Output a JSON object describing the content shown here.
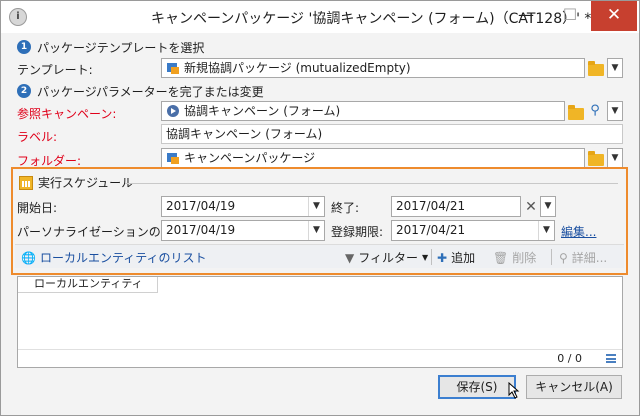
{
  "window": {
    "title": "キャンペーンパッケージ '協調キャンペーン (フォーム)（CAT128）' *",
    "app_icon": "i",
    "minimize": "—",
    "maximize": "☐",
    "close": "✕"
  },
  "steps": [
    {
      "num": "1",
      "label": "パッケージテンプレートを選択"
    },
    {
      "num": "2",
      "label": "パッケージパラメーターを完了または変更"
    }
  ],
  "form": {
    "template_label": "テンプレート:",
    "template_value": "新規協調パッケージ (mutualizedEmpty)",
    "ref_campaign_label": "参照キャンペーン:",
    "ref_campaign_value": "協調キャンペーン (フォーム)",
    "label_label": "ラベル:",
    "label_value": "協調キャンペーン (フォーム)",
    "folder_label": "フォルダー:",
    "folder_value": "キャンペーンパッケージ"
  },
  "schedule": {
    "heading": "実行スケジュール",
    "start_label": "開始日:",
    "start_value": "2017/04/19",
    "end_label": "終了:",
    "end_value": "2017/04/21",
    "perso_label": "パーソナライゼーションの期限:",
    "perso_value": "2017/04/19",
    "reg_label": "登録期限:",
    "reg_value": "2017/04/21",
    "edit_link": "編集..."
  },
  "toolbar": {
    "local_list": "ローカルエンティティのリスト",
    "filter": "フィルター",
    "add": "追加",
    "delete": "削除",
    "details": "詳細..."
  },
  "list": {
    "column": "ローカルエンティティ",
    "count": "0 / 0"
  },
  "buttons": {
    "save": "保存(S)",
    "cancel": "キャンセル(A)"
  },
  "colors": {
    "accent_orange": "#ee8b2d",
    "required_red": "#e0001a",
    "link_blue": "#1a4fa0",
    "close_red": "#c7402f"
  }
}
